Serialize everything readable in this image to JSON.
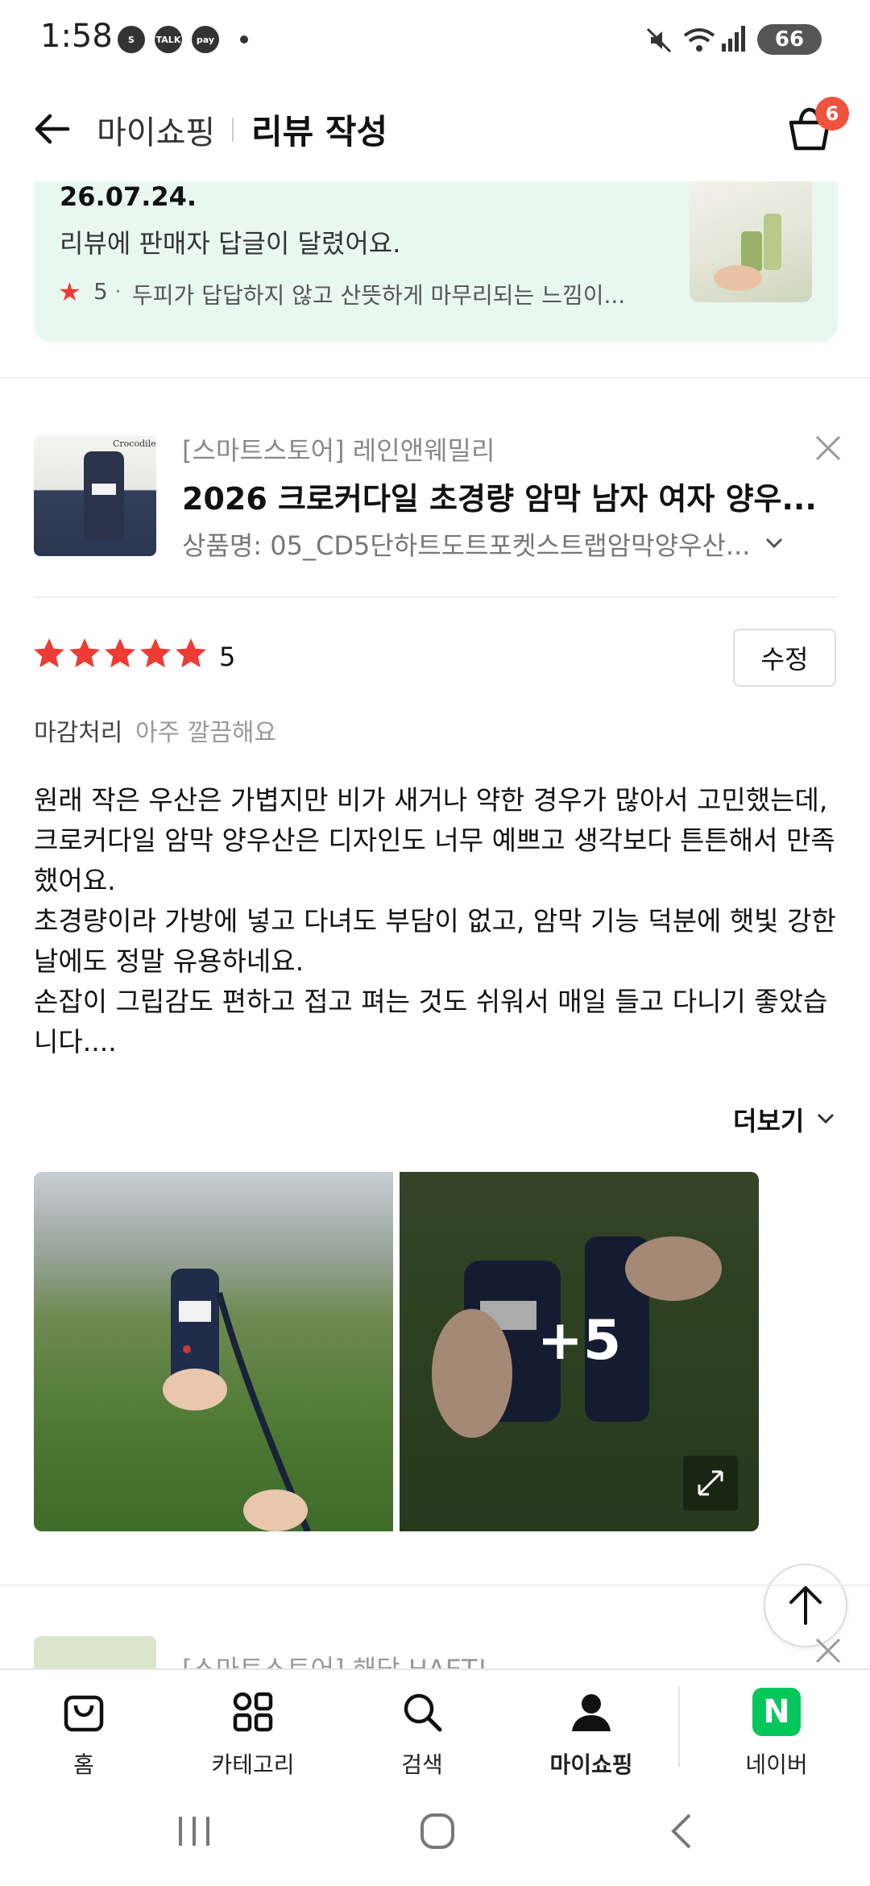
{
  "status_bar": {
    "time": "1:58",
    "apps": [
      "S",
      "TALK",
      "pay"
    ],
    "battery": "66"
  },
  "header": {
    "breadcrumb": "마이쇼핑",
    "title": "리뷰 작성",
    "cart_count": "6"
  },
  "notice": {
    "date": "26.07.24.",
    "message": "리뷰에 판매자 답글이 달렸어요.",
    "rating": "5",
    "separator": "·",
    "snippet": "두피가 답답하지 않고 산뜻하게 마무리되는 느낌이..."
  },
  "product": {
    "store": "[스마트스토어] 레인앤웨밀리",
    "name": "2026 크로커다일 초경량 암막 남자 여자 양우...",
    "option": "상품명: 05_CD5단하트도트포켓스트랩암막양우산..."
  },
  "review": {
    "stars": 5,
    "score": "5",
    "edit_label": "수정",
    "attribute_name": "마감처리",
    "attribute_value": "아주 깔끔해요",
    "text": "원래 작은 우산은 가볍지만 비가 새거나 약한 경우가 많아서 고민했는데, 크로커다일 암막 양우산은 디자인도 너무 예쁘고 생각보다 튼튼해서 만족했어요.\n초경량이라 가방에 넣고 다녀도 부담이 없고, 암막 기능 덕분에 햇빛 강한 날에도 정말 유용하네요.\n손잡이 그립감도 편하고 접고 펴는 것도 쉬워서 매일 들고 다니기 좋았습니다....",
    "more_label": "더보기",
    "photo_more": "+5"
  },
  "next_item": {
    "store": "[스마트스토어] 해당 HAET!"
  },
  "bottom_nav": {
    "home": "홈",
    "category": "카테고리",
    "search": "검색",
    "myshopping": "마이쇼핑",
    "naver": "네이버",
    "naver_logo": "N"
  },
  "colors": {
    "accent_red": "#ee3b33",
    "notice_bg": "#e9f7f1",
    "naver_green": "#03c75a"
  }
}
